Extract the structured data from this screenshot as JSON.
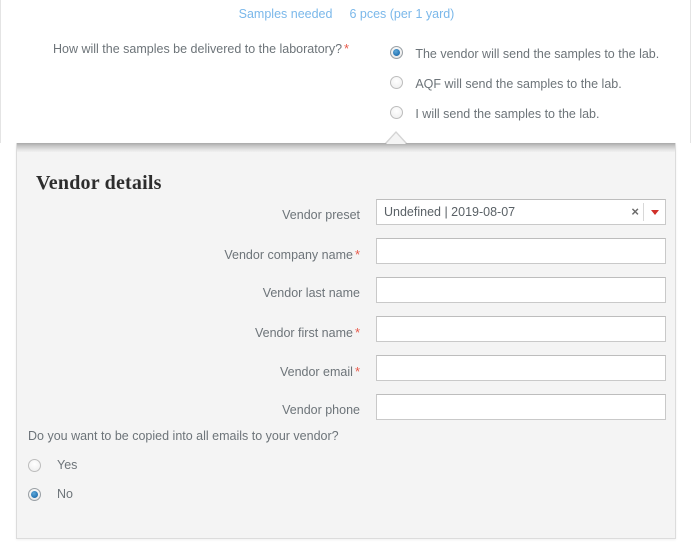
{
  "header": {
    "samples_label": "Samples needed",
    "samples_value": "6 pces (per 1 yard)",
    "link_color": "#7bb8ea"
  },
  "delivery_question": {
    "label": "How will the samples be delivered to the laboratory?",
    "required_marker": "*",
    "options": [
      {
        "label": "The vendor will send the samples to the lab.",
        "selected": true
      },
      {
        "label": "AQF will send the samples to the lab.",
        "selected": false
      },
      {
        "label": "I will send the samples to the lab.",
        "selected": false
      }
    ]
  },
  "panel": {
    "title": "Vendor details",
    "fields": [
      {
        "label": "Vendor preset",
        "required": false,
        "type": "combo",
        "value": "Undefined | 2019-08-07",
        "clear_icon": "×",
        "placeholder": ""
      },
      {
        "label": "Vendor company name",
        "required": true,
        "type": "text",
        "value": "",
        "placeholder": ""
      },
      {
        "label": "Vendor last name",
        "required": false,
        "type": "text",
        "value": "",
        "placeholder": ""
      },
      {
        "label": "Vendor first name",
        "required": true,
        "type": "text",
        "value": "",
        "placeholder": ""
      },
      {
        "label": "Vendor email",
        "required": true,
        "type": "text",
        "value": "",
        "placeholder": ""
      },
      {
        "label": "Vendor phone",
        "required": false,
        "type": "text",
        "value": "",
        "placeholder": ""
      }
    ],
    "copy_question": {
      "label": "Do you want to be copied into all emails to your vendor?",
      "options": [
        {
          "label": "Yes",
          "selected": false
        },
        {
          "label": "No",
          "selected": true
        }
      ]
    }
  },
  "colors": {
    "required_red": "#e8594a",
    "dropdown_arrow_red": "#d0302a",
    "radio_blue": "#2b7ab8",
    "panel_bg": "#f4f4f4",
    "text": "#6d7479"
  }
}
